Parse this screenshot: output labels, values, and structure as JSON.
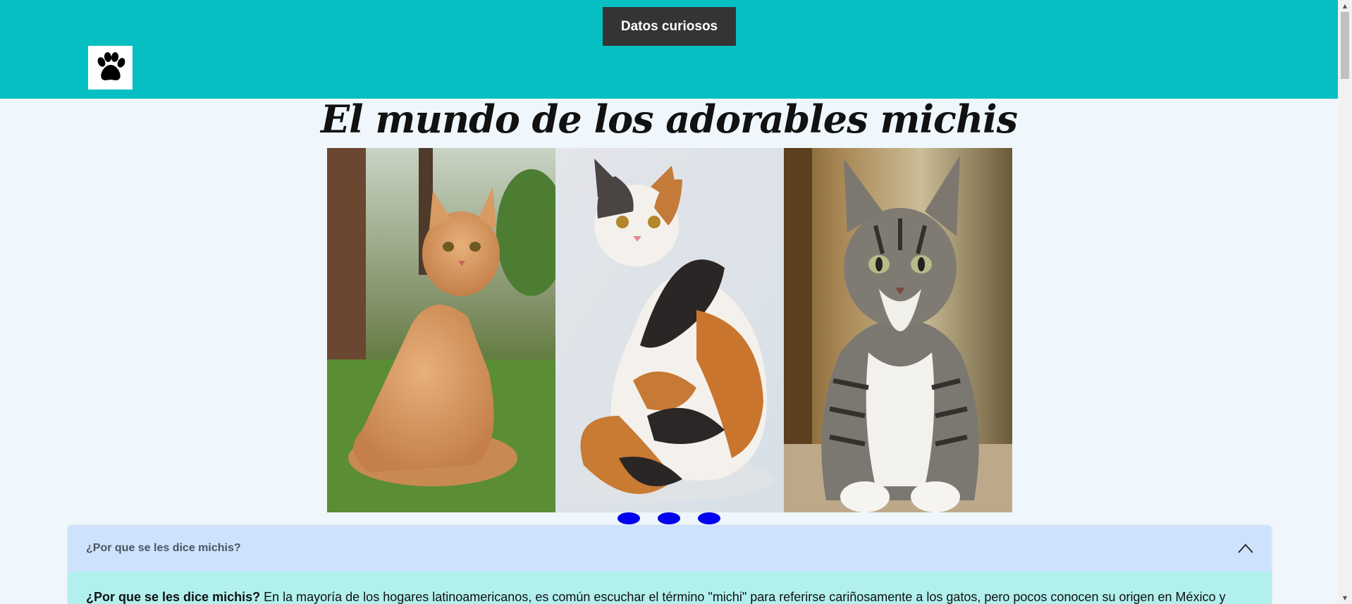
{
  "header": {
    "nav_button_label": "Datos curiosos",
    "logo_icon": "paw-icon",
    "background_color": "#05bfc2"
  },
  "main": {
    "title": "El mundo de los adorables michis"
  },
  "carousel": {
    "slides": [
      {
        "alt": "orange-tabby-cat"
      },
      {
        "alt": "calico-cat"
      },
      {
        "alt": "grey-tabby-kitten"
      }
    ],
    "indicator_color": "#0000f0"
  },
  "accordion": {
    "header_label": "¿Por que se les dice michis?",
    "toggle_icon": "chevron-up-icon",
    "body_lead": "¿Por que se les dice michis?",
    "body_text": "En la mayoría de los hogares latinoamericanos, es común escuchar el término \"michi\" para referirse cariñosamente a los gatos, pero pocos conocen su origen en México y"
  }
}
